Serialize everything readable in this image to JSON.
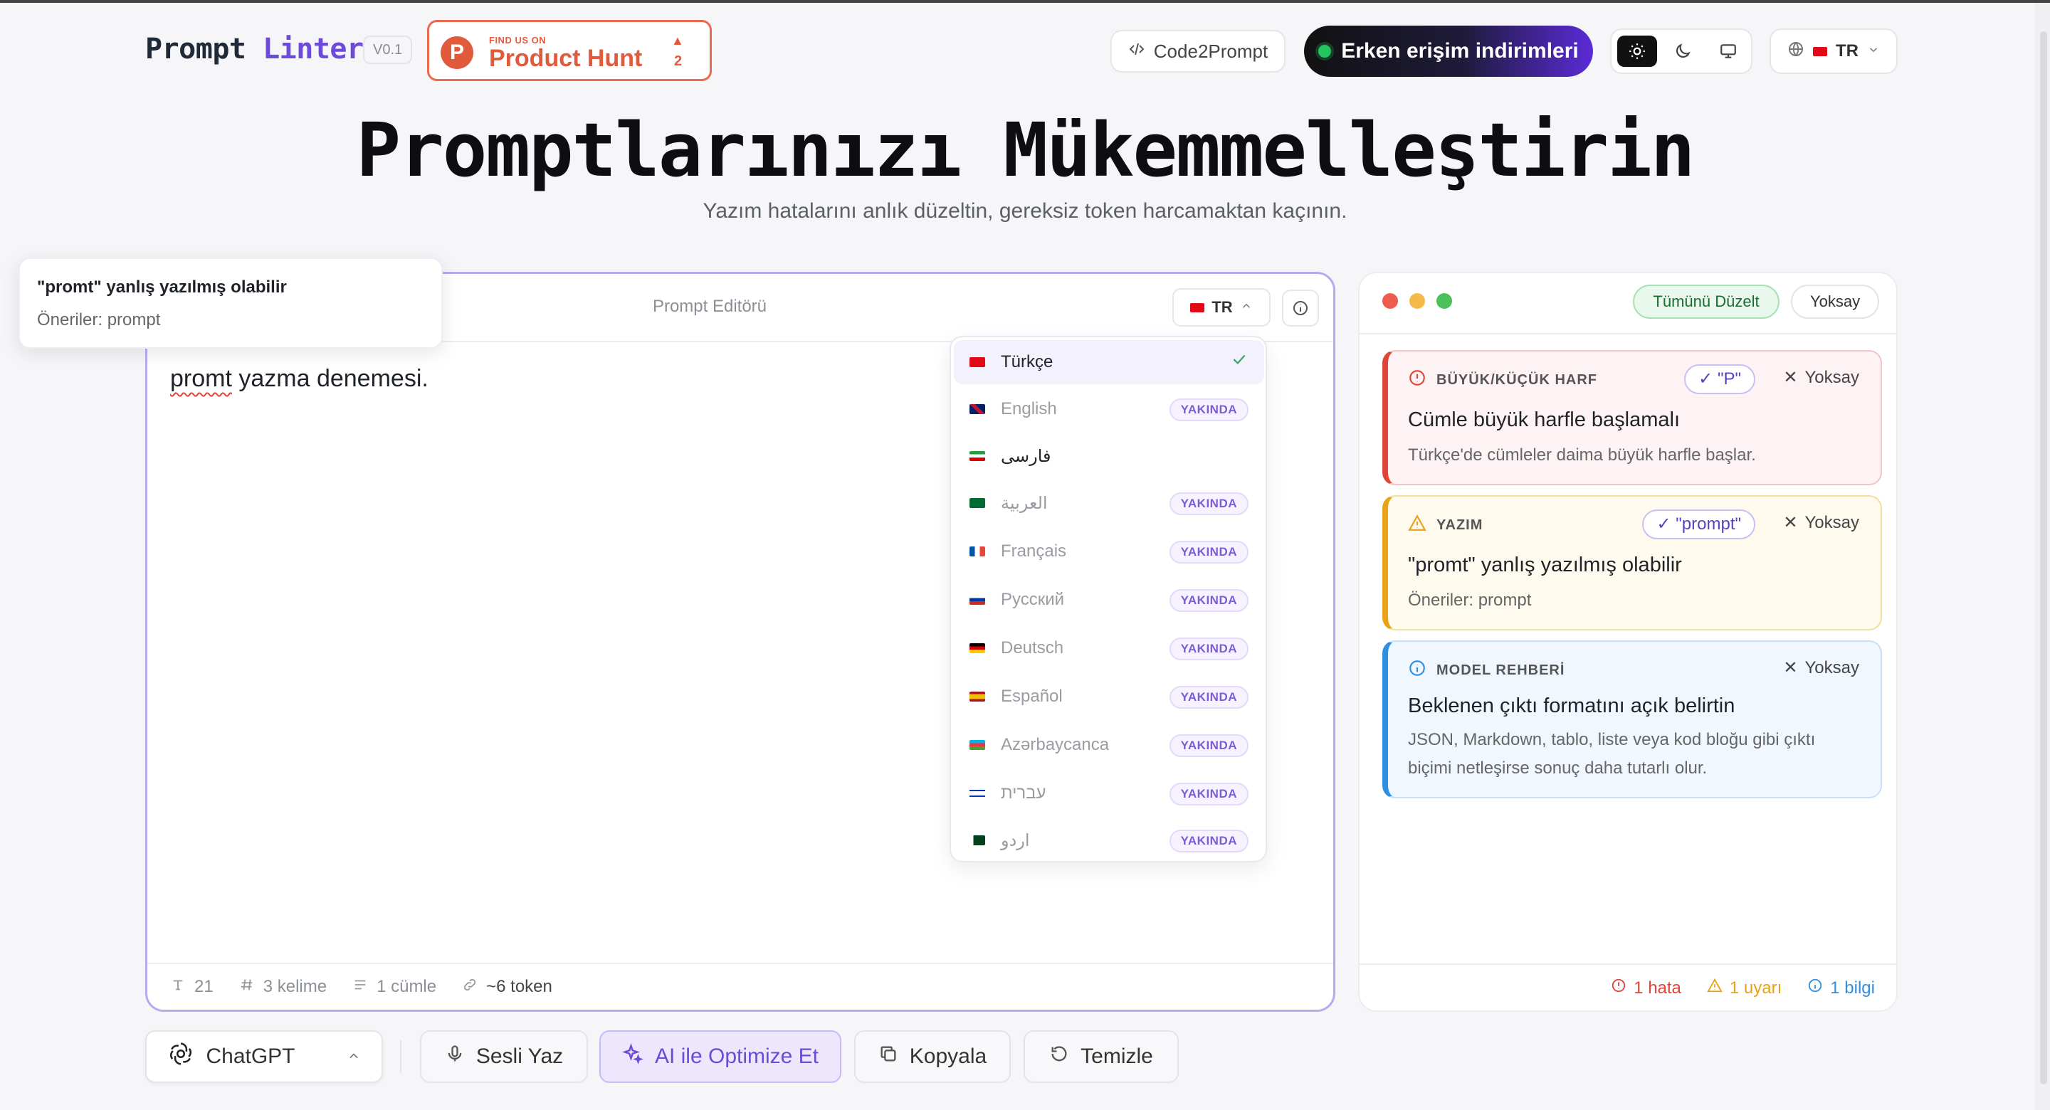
{
  "header": {
    "logo_part1": "Prompt",
    "logo_part2": "Linter",
    "version": "V0.1",
    "product_hunt": {
      "find_us": "FIND US ON",
      "name": "Product Hunt",
      "votes": "2"
    },
    "code2prompt": "Code2Prompt",
    "early_access": "Erken erişim indirimleri",
    "lang": "TR"
  },
  "hero": {
    "title": "Promptlarınızı Mükemmelleştirin",
    "subtitle": "Yazım hatalarını anlık düzeltin, gereksiz token harcamaktan kaçının."
  },
  "tooltip": {
    "title": "\"promt\" yanlış yazılmış olabilir",
    "suggestion": "Öneriler: prompt"
  },
  "editor": {
    "title": "Prompt Editörü",
    "lang": "TR",
    "text_misspelled": "promt",
    "text_rest": " yazma denemesi.",
    "stats": {
      "chars": "21",
      "words": "3 kelime",
      "sentences": "1 cümle",
      "tokens": "~6 token"
    }
  },
  "dropdown": {
    "items": [
      {
        "label": "Türkçe",
        "flag": "tr",
        "selected": true
      },
      {
        "label": "English",
        "flag": "gb",
        "badge": "YAKINDA"
      },
      {
        "label": "فارسی",
        "flag": "ir"
      },
      {
        "label": "العربية",
        "flag": "sa",
        "badge": "YAKINDA"
      },
      {
        "label": "Français",
        "flag": "fr",
        "badge": "YAKINDA"
      },
      {
        "label": "Русский",
        "flag": "ru",
        "badge": "YAKINDA"
      },
      {
        "label": "Deutsch",
        "flag": "de",
        "badge": "YAKINDA"
      },
      {
        "label": "Español",
        "flag": "es",
        "badge": "YAKINDA"
      },
      {
        "label": "Azərbaycanca",
        "flag": "az",
        "badge": "YAKINDA"
      },
      {
        "label": "עברית",
        "flag": "il",
        "badge": "YAKINDA"
      },
      {
        "label": "اردو",
        "flag": "pk",
        "badge": "YAKINDA"
      }
    ]
  },
  "results": {
    "fix_all": "Tümünü Düzelt",
    "ignore_all": "Yoksay",
    "cards": [
      {
        "category": "BÜYÜK/KÜÇÜK HARF",
        "fix": "\"P\"",
        "ignore": "Yoksay",
        "title": "Cümle büyük harfle başlamalı",
        "desc": "Türkçe'de cümleler daima büyük harfle başlar."
      },
      {
        "category": "YAZIM",
        "fix": "\"prompt\"",
        "ignore": "Yoksay",
        "title": "\"promt\" yanlış yazılmış olabilir",
        "desc": "Öneriler: prompt"
      },
      {
        "category": "MODEL REHBERİ",
        "ignore": "Yoksay",
        "title": "Beklenen çıktı formatını açık belirtin",
        "desc": "JSON, Markdown, tablo, liste veya kod bloğu gibi çıktı biçimi netleşirse sonuç daha tutarlı olur."
      }
    ],
    "footer": {
      "errors": "1 hata",
      "warnings": "1 uyarı",
      "info": "1 bilgi"
    }
  },
  "toolbar": {
    "model": "ChatGPT",
    "voice": "Sesli Yaz",
    "ai_optimize": "AI ile Optimize Et",
    "copy": "Kopyala",
    "clear": "Temizle"
  },
  "colors": {
    "accent": "#6d4ad8",
    "error": "#e0453a",
    "warning": "#e8a317",
    "info": "#2f8fe0",
    "success": "#1d6b34"
  }
}
